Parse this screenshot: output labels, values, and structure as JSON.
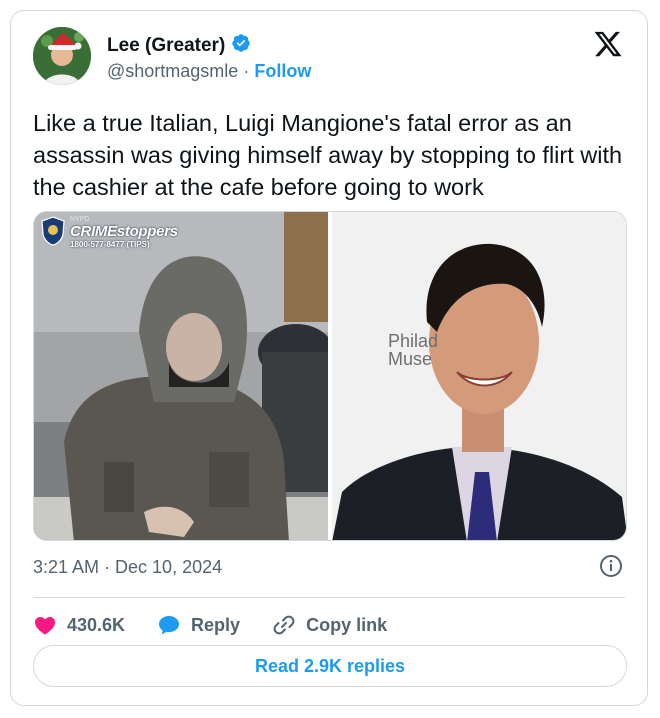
{
  "author": {
    "display_name": "Lee (Greater)",
    "handle": "@shortmagsmle",
    "separator": "·",
    "follow_label": "Follow",
    "verified": true
  },
  "tweet": {
    "text": "Like a true Italian, Luigi Mangione's fatal error as an assassin was giving himself away by stopping to flirt with the cashier at the cafe before going to work",
    "timestamp": "3:21 AM · Dec 10, 2024"
  },
  "media": {
    "left_image": {
      "badge_org": "NYPD",
      "badge_title": "CRIMEstoppers",
      "badge_phone": "1800-577-8477 (TIPS)"
    },
    "right_image": {
      "backdrop_line1": "Philad",
      "backdrop_line2": "Muse"
    }
  },
  "actions": {
    "likes": "430.6K",
    "reply_label": "Reply",
    "copy_link_label": "Copy link"
  },
  "read_replies_label": "Read 2.9K replies",
  "colors": {
    "accent": "#1d9bf0",
    "like": "#f91880",
    "text_secondary": "#536471",
    "border": "#cfd9de"
  },
  "icons": [
    "verified-badge-icon",
    "x-logo-icon",
    "info-icon",
    "heart-icon",
    "reply-bubble-icon",
    "link-icon"
  ]
}
